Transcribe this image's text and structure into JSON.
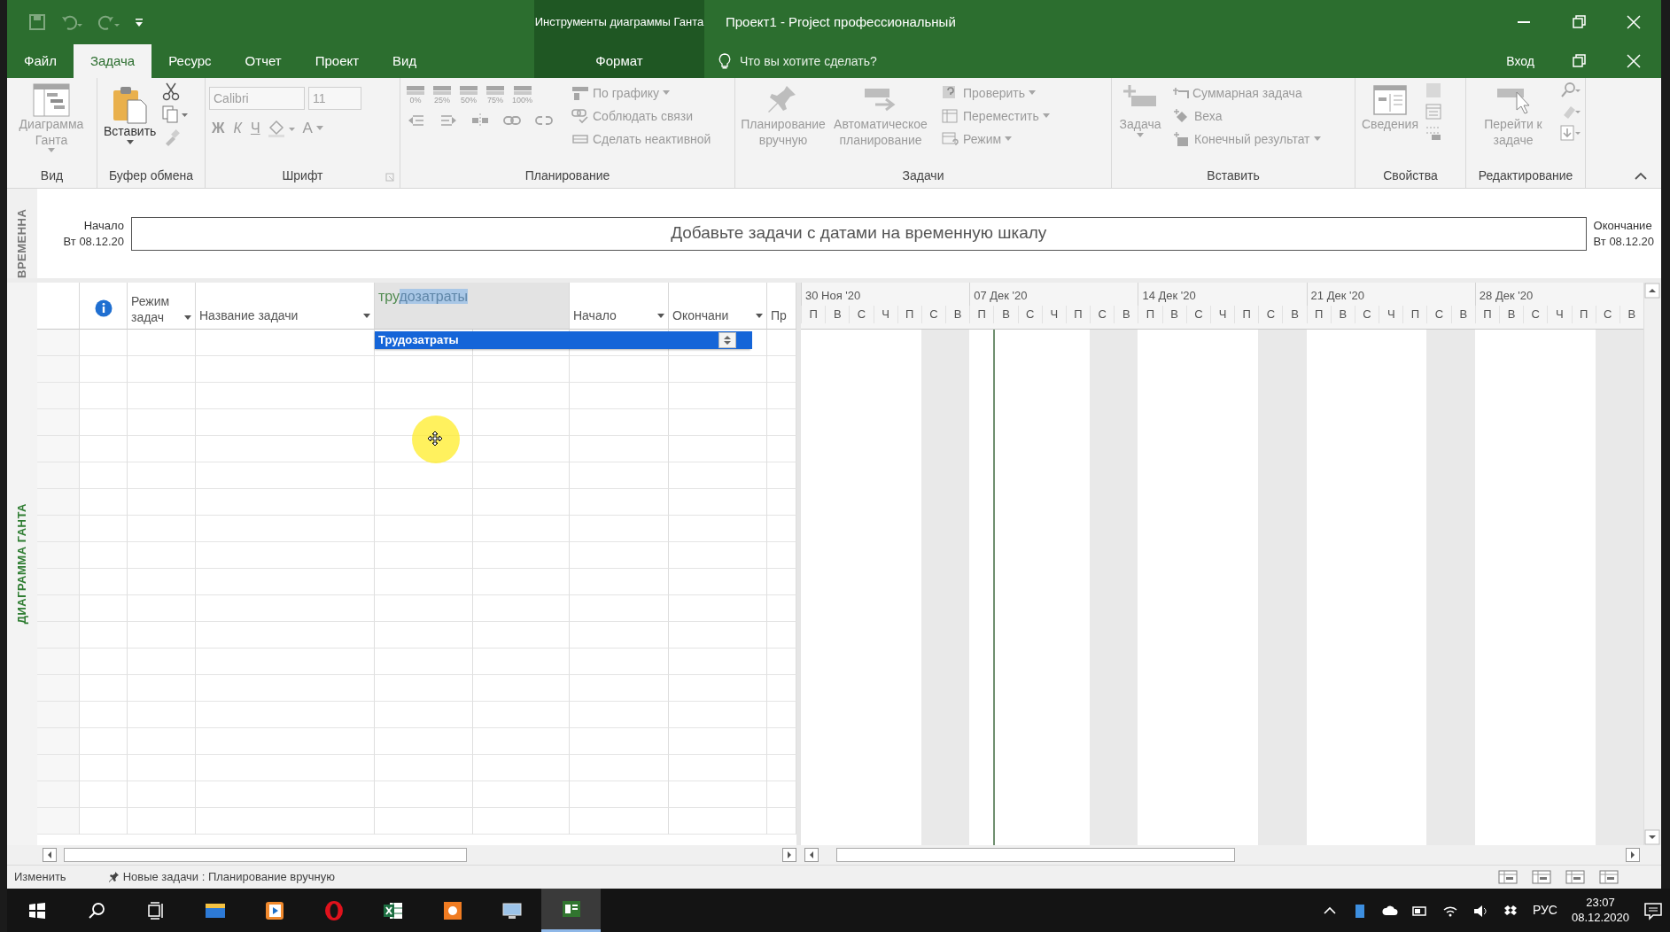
{
  "window": {
    "title": "Проект1 - Project профессиональный",
    "context_title": "Инструменты диаграммы Ганта"
  },
  "ribbon_tabs": [
    {
      "label": "Файл",
      "kind": "file",
      "selected": false
    },
    {
      "label": "Задача",
      "kind": "main",
      "selected": true
    },
    {
      "label": "Ресурс",
      "kind": "main",
      "selected": false
    },
    {
      "label": "Отчет",
      "kind": "main",
      "selected": false
    },
    {
      "label": "Проект",
      "kind": "main",
      "selected": false
    },
    {
      "label": "Вид",
      "kind": "main",
      "selected": false
    },
    {
      "label": "Формат",
      "kind": "context",
      "selected": false
    }
  ],
  "tell_me": {
    "placeholder": "Что вы хотите сделать?"
  },
  "sign_in": "Вход",
  "ribbon_groups": [
    {
      "kind": "view",
      "label": "Вид",
      "buttons": [
        {
          "label": "Диаграмма Ганта",
          "disabled": true
        }
      ]
    },
    {
      "kind": "clipboard",
      "label": "Буфер обмена",
      "buttons": [
        {
          "label": "Вставить",
          "disabled": false
        }
      ]
    },
    {
      "kind": "font",
      "label": "Шрифт",
      "font": {
        "value": "Calibri",
        "disabled": true
      },
      "size": {
        "value": "11",
        "disabled": true
      },
      "buttons": [
        {
          "label": "Ж",
          "disabled": true
        },
        {
          "label": "К",
          "disabled": true
        },
        {
          "label": "Ч",
          "disabled": true
        },
        {
          "label": "А",
          "disabled": true
        }
      ]
    },
    {
      "kind": "schedule",
      "label": "Планирование",
      "buttons": [
        {
          "label": "0%",
          "disabled": true
        },
        {
          "label": "25%",
          "disabled": true
        },
        {
          "label": "50%",
          "disabled": true
        },
        {
          "label": "75%",
          "disabled": true
        },
        {
          "label": "100%",
          "disabled": true
        },
        {
          "label": "По графику",
          "disabled": true
        },
        {
          "label": "Соблюдать связи",
          "disabled": true
        },
        {
          "label": "Сделать неактивной",
          "disabled": true
        }
      ]
    },
    {
      "kind": "tasks",
      "label": "Задачи",
      "buttons": [
        {
          "label": "Планирование вручную",
          "disabled": true
        },
        {
          "label": "Автоматическое планирование",
          "disabled": true
        },
        {
          "label": "Проверить",
          "disabled": true
        },
        {
          "label": "Переместить",
          "disabled": true
        },
        {
          "label": "Режим",
          "disabled": true
        }
      ]
    },
    {
      "kind": "insert",
      "label": "Вставить",
      "buttons": [
        {
          "label": "Задача",
          "disabled": true
        },
        {
          "label": "Суммарная задача",
          "disabled": true
        },
        {
          "label": "Веха",
          "disabled": true
        },
        {
          "label": "Конечный результат",
          "disabled": true
        }
      ]
    },
    {
      "kind": "properties",
      "label": "Свойства",
      "buttons": [
        {
          "label": "Сведения",
          "disabled": true
        }
      ]
    },
    {
      "kind": "editing",
      "label": "Редактирование",
      "buttons": [
        {
          "label": "Перейти к задаче",
          "disabled": true
        }
      ]
    }
  ],
  "views_bar": {
    "timeline_label": "ВРЕМЕННА",
    "gantt_label": "ДИАГРАММА ГАНТА"
  },
  "timeline": {
    "start_label": "Начало",
    "start_date": "Вт 08.12.20",
    "hint_text": "Добавьте задачи с датами на временную шкалу",
    "finish_label": "Окончание",
    "finish_date": "Вт 08.12.20"
  },
  "table": {
    "columns": [
      {
        "kind": "indicator"
      },
      {
        "kind": "header",
        "label": "Режим задач",
        "dropdown": true
      },
      {
        "kind": "header",
        "label": "Название задачи",
        "dropdown": true
      },
      {
        "kind": "edit",
        "value_plain": "тру",
        "value_selected": "дозатраты"
      },
      {
        "kind": "header",
        "label": "Начало",
        "dropdown": true
      },
      {
        "kind": "header",
        "label": "Окончани",
        "dropdown": true
      },
      {
        "kind": "header",
        "label": "Пр",
        "dropdown": false
      }
    ],
    "autocomplete": [
      {
        "label": "Трудозатраты",
        "selected": true
      }
    ]
  },
  "gantt": {
    "weeks": [
      {
        "label": "30 Ноя '20",
        "days": [
          {
            "label": "П",
            "nonworking": false,
            "current": false
          },
          {
            "label": "В",
            "nonworking": false,
            "current": false
          },
          {
            "label": "С",
            "nonworking": false,
            "current": false
          },
          {
            "label": "Ч",
            "nonworking": false,
            "current": false
          },
          {
            "label": "П",
            "nonworking": false,
            "current": false
          },
          {
            "label": "С",
            "nonworking": true,
            "current": false
          },
          {
            "label": "В",
            "nonworking": true,
            "current": false
          }
        ]
      },
      {
        "label": "07 Дек '20",
        "days": [
          {
            "label": "П",
            "nonworking": false,
            "current": false
          },
          {
            "label": "В",
            "nonworking": false,
            "current": true
          },
          {
            "label": "С",
            "nonworking": false,
            "current": false
          },
          {
            "label": "Ч",
            "nonworking": false,
            "current": false
          },
          {
            "label": "П",
            "nonworking": false,
            "current": false
          },
          {
            "label": "С",
            "nonworking": true,
            "current": false
          },
          {
            "label": "В",
            "nonworking": true,
            "current": false
          }
        ]
      },
      {
        "label": "14 Дек '20",
        "days": [
          {
            "label": "П",
            "nonworking": false,
            "current": false
          },
          {
            "label": "В",
            "nonworking": false,
            "current": false
          },
          {
            "label": "С",
            "nonworking": false,
            "current": false
          },
          {
            "label": "Ч",
            "nonworking": false,
            "current": false
          },
          {
            "label": "П",
            "nonworking": false,
            "current": false
          },
          {
            "label": "С",
            "nonworking": true,
            "current": false
          },
          {
            "label": "В",
            "nonworking": true,
            "current": false
          }
        ]
      },
      {
        "label": "21 Дек '20",
        "days": [
          {
            "label": "П",
            "nonworking": false,
            "current": false
          },
          {
            "label": "В",
            "nonworking": false,
            "current": false
          },
          {
            "label": "С",
            "nonworking": false,
            "current": false
          },
          {
            "label": "Ч",
            "nonworking": false,
            "current": false
          },
          {
            "label": "П",
            "nonworking": false,
            "current": false
          },
          {
            "label": "С",
            "nonworking": true,
            "current": false
          },
          {
            "label": "В",
            "nonworking": true,
            "current": false
          }
        ]
      },
      {
        "label": "28 Дек '20",
        "days": [
          {
            "label": "П",
            "nonworking": false,
            "current": false
          },
          {
            "label": "В",
            "nonworking": false,
            "current": false
          },
          {
            "label": "С",
            "nonworking": false,
            "current": false
          },
          {
            "label": "Ч",
            "nonworking": false,
            "current": false
          },
          {
            "label": "П",
            "nonworking": false,
            "current": false
          },
          {
            "label": "С",
            "nonworking": true,
            "current": false
          },
          {
            "label": "В",
            "nonworking": true,
            "current": false
          }
        ]
      }
    ]
  },
  "status_bar": {
    "mode": "Изменить",
    "new_tasks": "Новые задачи : Планирование вручную"
  },
  "taskbar": {
    "apps": [
      {
        "selected": false
      },
      {
        "selected": false
      },
      {
        "selected": false
      },
      {
        "selected": false
      },
      {
        "selected": false
      },
      {
        "selected": false
      },
      {
        "selected": true
      }
    ],
    "language": "РУС",
    "time": "23:07",
    "date": "08.12.2020"
  }
}
